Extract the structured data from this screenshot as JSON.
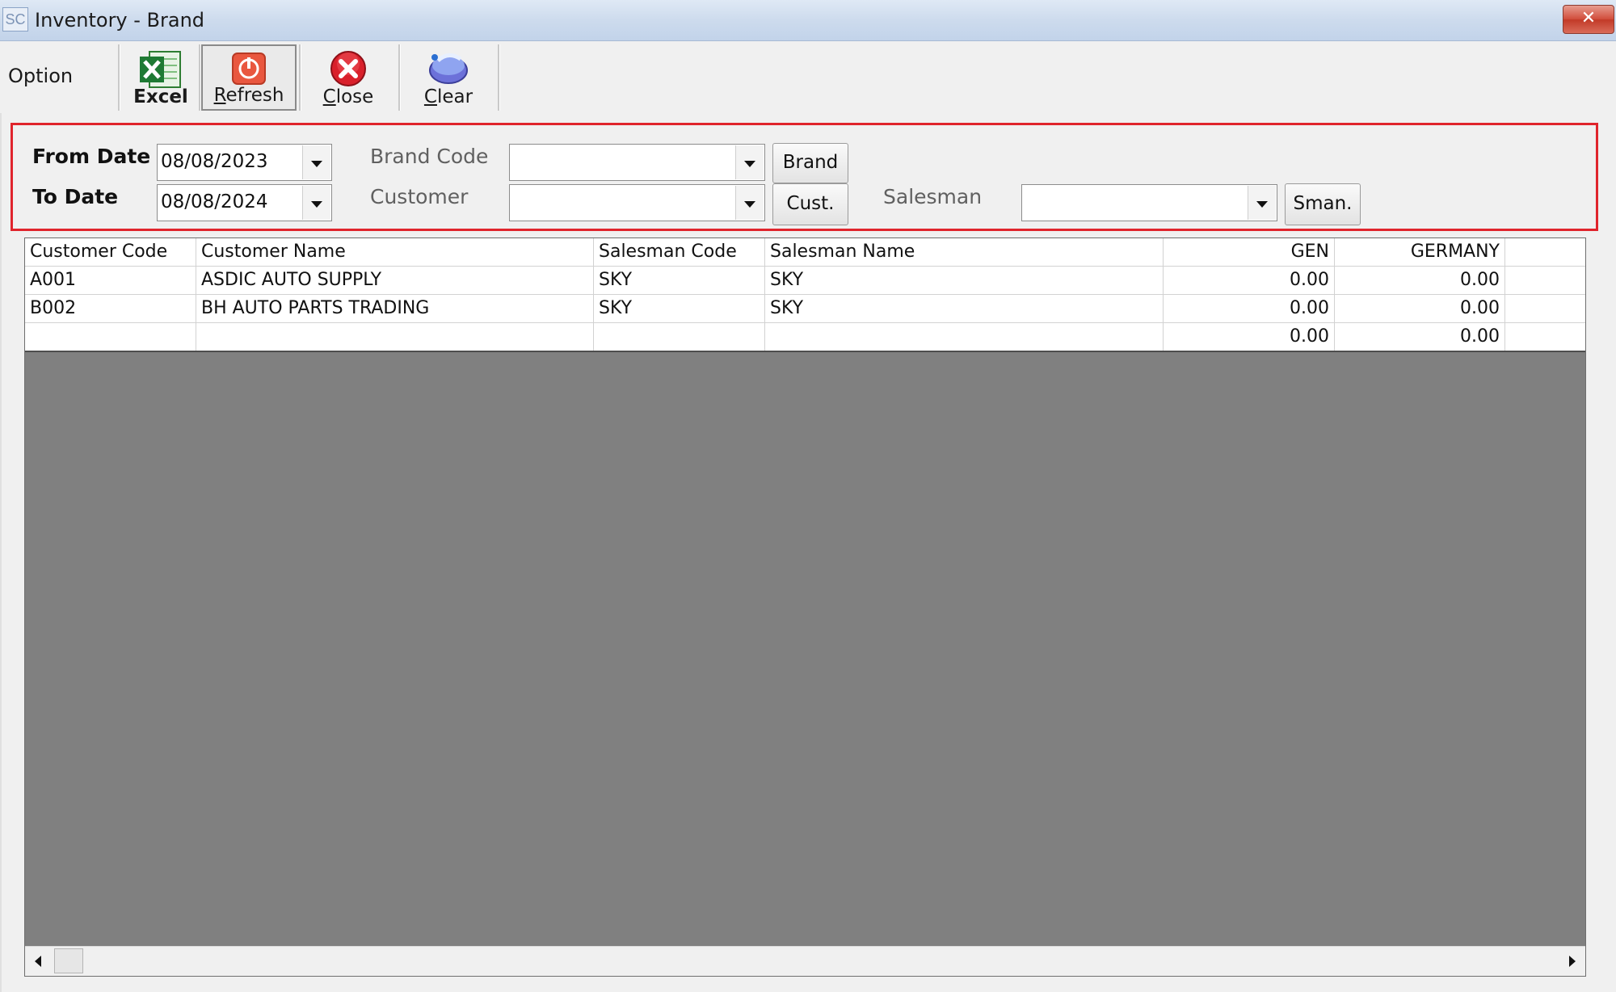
{
  "window": {
    "icon_text": "SC",
    "title": "Inventory - Brand",
    "close_glyph": "✕"
  },
  "toolbar": {
    "option_label": "Option",
    "buttons": [
      {
        "label": "Excel",
        "icon": "excel-icon"
      },
      {
        "label": "Refresh",
        "icon": "refresh-icon"
      },
      {
        "label": "Close",
        "icon": "close-circle-icon"
      },
      {
        "label": "Clear",
        "icon": "clear-icon"
      }
    ]
  },
  "filters": {
    "from_date_label": "From Date",
    "from_date_value": "08/08/2023",
    "to_date_label": "To Date",
    "to_date_value": "08/08/2024",
    "brand_code_label": "Brand Code",
    "brand_code_value": "",
    "brand_button": "Brand",
    "customer_label": "Customer",
    "customer_value": "",
    "customer_button": "Cust.",
    "salesman_label": "Salesman",
    "salesman_value": "",
    "salesman_button": "Sman.",
    "highlight_color": "#e0242c"
  },
  "grid": {
    "headers": [
      "Customer Code",
      "Customer Name",
      "Salesman Code",
      "Salesman Name",
      "GEN",
      "GERMANY"
    ],
    "rows": [
      [
        "A001",
        "ASDIC AUTO SUPPLY",
        "SKY",
        "SKY",
        "0.00",
        "0.00"
      ],
      [
        "B002",
        "BH AUTO PARTS TRADING",
        "SKY",
        "SKY",
        "0.00",
        "0.00"
      ],
      [
        "",
        "",
        "",
        "",
        "0.00",
        "0.00"
      ]
    ]
  }
}
